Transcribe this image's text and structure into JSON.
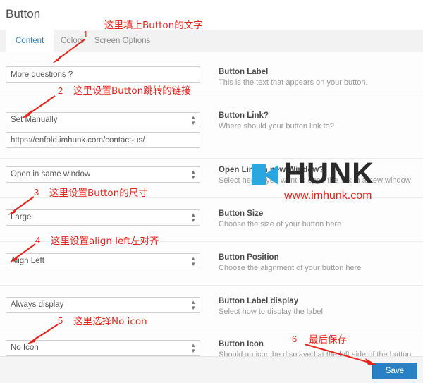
{
  "window": {
    "title": "Button"
  },
  "tabs": [
    {
      "label": "Content",
      "active": true
    },
    {
      "label": "Colors",
      "active": false
    },
    {
      "label": "Screen Options",
      "active": false
    }
  ],
  "fields": [
    {
      "name": "button-label",
      "control": "text",
      "value": "More questions ?",
      "desc_title": "Button Label",
      "desc_sub": "This is the text that appears on your button."
    },
    {
      "name": "button-link-mode",
      "control": "select",
      "value": "Set Manually",
      "desc_title": "Button Link?",
      "desc_sub": "Where should your button link to?"
    },
    {
      "name": "button-link-url",
      "control": "text",
      "value": "https://enfold.imhunk.com/contact-us/",
      "desc_title": "",
      "desc_sub": ""
    },
    {
      "name": "open-link-window",
      "control": "select",
      "value": "Open in same window",
      "desc_title": "Open Link in new Window?",
      "desc_sub": "Select here if you want to open the link in a new window"
    },
    {
      "name": "button-size",
      "control": "select",
      "value": "Large",
      "desc_title": "Button Size",
      "desc_sub": "Choose the size of your button here"
    },
    {
      "name": "button-position",
      "control": "select",
      "value": "Align Left",
      "desc_title": "Button Position",
      "desc_sub": "Choose the alignment of your button here"
    },
    {
      "name": "button-label-display",
      "control": "select",
      "value": "Always display",
      "desc_title": "Button Label display",
      "desc_sub": "Select how to display the label"
    },
    {
      "name": "button-icon",
      "control": "select",
      "value": "No Icon",
      "desc_title": "Button Icon",
      "desc_sub": "Should an icon be displayed at the left side of the button"
    }
  ],
  "footer": {
    "save_label": "Save"
  },
  "annotations": [
    {
      "num": "1",
      "text": "这里填上Button的文字"
    },
    {
      "num": "2",
      "text": "这里设置Button跳转的链接"
    },
    {
      "num": "3",
      "text": "这里设置Button的尺寸"
    },
    {
      "num": "4",
      "text": "这里设置align left左对齐"
    },
    {
      "num": "5",
      "text": "这里选择No icon"
    },
    {
      "num": "6",
      "text": "最后保存"
    }
  ],
  "watermark": {
    "text": "HUNK",
    "url": "www.imhunk.com"
  },
  "colors": {
    "accent": "#2980c4",
    "annotation": "#e8231a",
    "tab_active_text": "#2f7fbf"
  }
}
